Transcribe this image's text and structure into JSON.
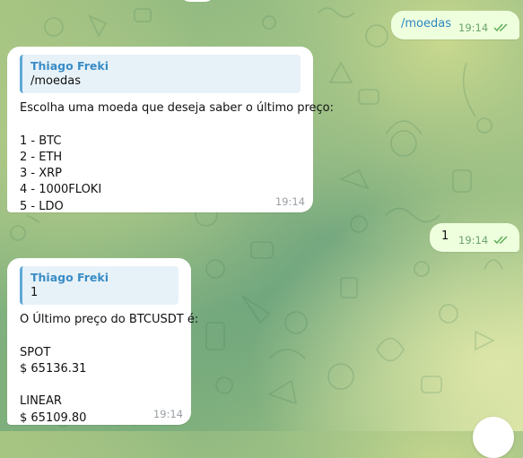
{
  "messages": {
    "cmd_moedas": {
      "text": "/moedas",
      "time": "19:14"
    },
    "menu": {
      "reply_name": "Thiago Freki",
      "reply_text": "/moedas",
      "lines": [
        "Escolha uma moeda que deseja saber o último preço:",
        "",
        "1 - BTC",
        "2 - ETH",
        "3 - XRP",
        "4 - 1000FLOKI",
        "5 - LDO"
      ],
      "time": "19:14"
    },
    "choice": {
      "text": "1",
      "time": "19:14"
    },
    "price": {
      "reply_name": "Thiago Freki",
      "reply_text": "1",
      "lines": [
        "O Último preço do BTCUSDT é:",
        "",
        "SPOT",
        "$ 65136.31",
        "",
        "LINEAR",
        "$ 65109.80"
      ],
      "time": "19:14"
    }
  },
  "icons": {
    "read_receipt": "double-check-icon"
  },
  "colors": {
    "outgoing_bubble": "#eeffde",
    "incoming_bubble": "#ffffff",
    "accent": "#3a8cc6"
  }
}
